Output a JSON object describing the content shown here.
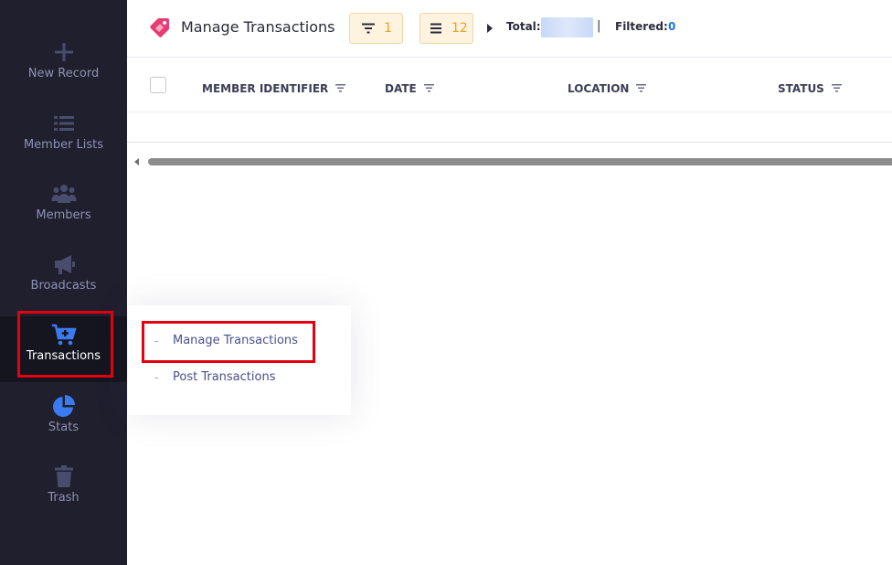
{
  "sidebar": {
    "items": [
      {
        "label": "New Record",
        "icon": "plus-icon"
      },
      {
        "label": "Member Lists",
        "icon": "list-icon"
      },
      {
        "label": "Members",
        "icon": "users-icon"
      },
      {
        "label": "Broadcasts",
        "icon": "megaphone-icon"
      },
      {
        "label": "Transactions",
        "icon": "cart-icon",
        "active": true
      },
      {
        "label": "Stats",
        "icon": "pie-chart-icon"
      },
      {
        "label": "Trash",
        "icon": "trash-icon"
      }
    ]
  },
  "header": {
    "title": "Manage Transactions",
    "title_icon": "tag-icon",
    "filter_count": "1",
    "columns_count": "12",
    "total_label": "Total:",
    "separator": "|",
    "filtered_label": "Filtered:",
    "filtered_value": "0"
  },
  "table": {
    "columns": [
      "MEMBER IDENTIFIER",
      "DATE",
      "LOCATION",
      "STATUS"
    ]
  },
  "submenu": {
    "items": [
      {
        "dash": "-",
        "label": "Manage Transactions"
      },
      {
        "dash": "-",
        "label": "Post Transactions"
      }
    ]
  },
  "colors": {
    "sidebar_bg": "#1f1f2e",
    "sidebar_icon": "#4a4c6e",
    "active_icon": "#3a7bf0",
    "highlight_box": "#e3000f",
    "pill_number": "#f49b21",
    "filtered_value": "#1a73e8",
    "submenu_text": "#4a4f8a"
  }
}
